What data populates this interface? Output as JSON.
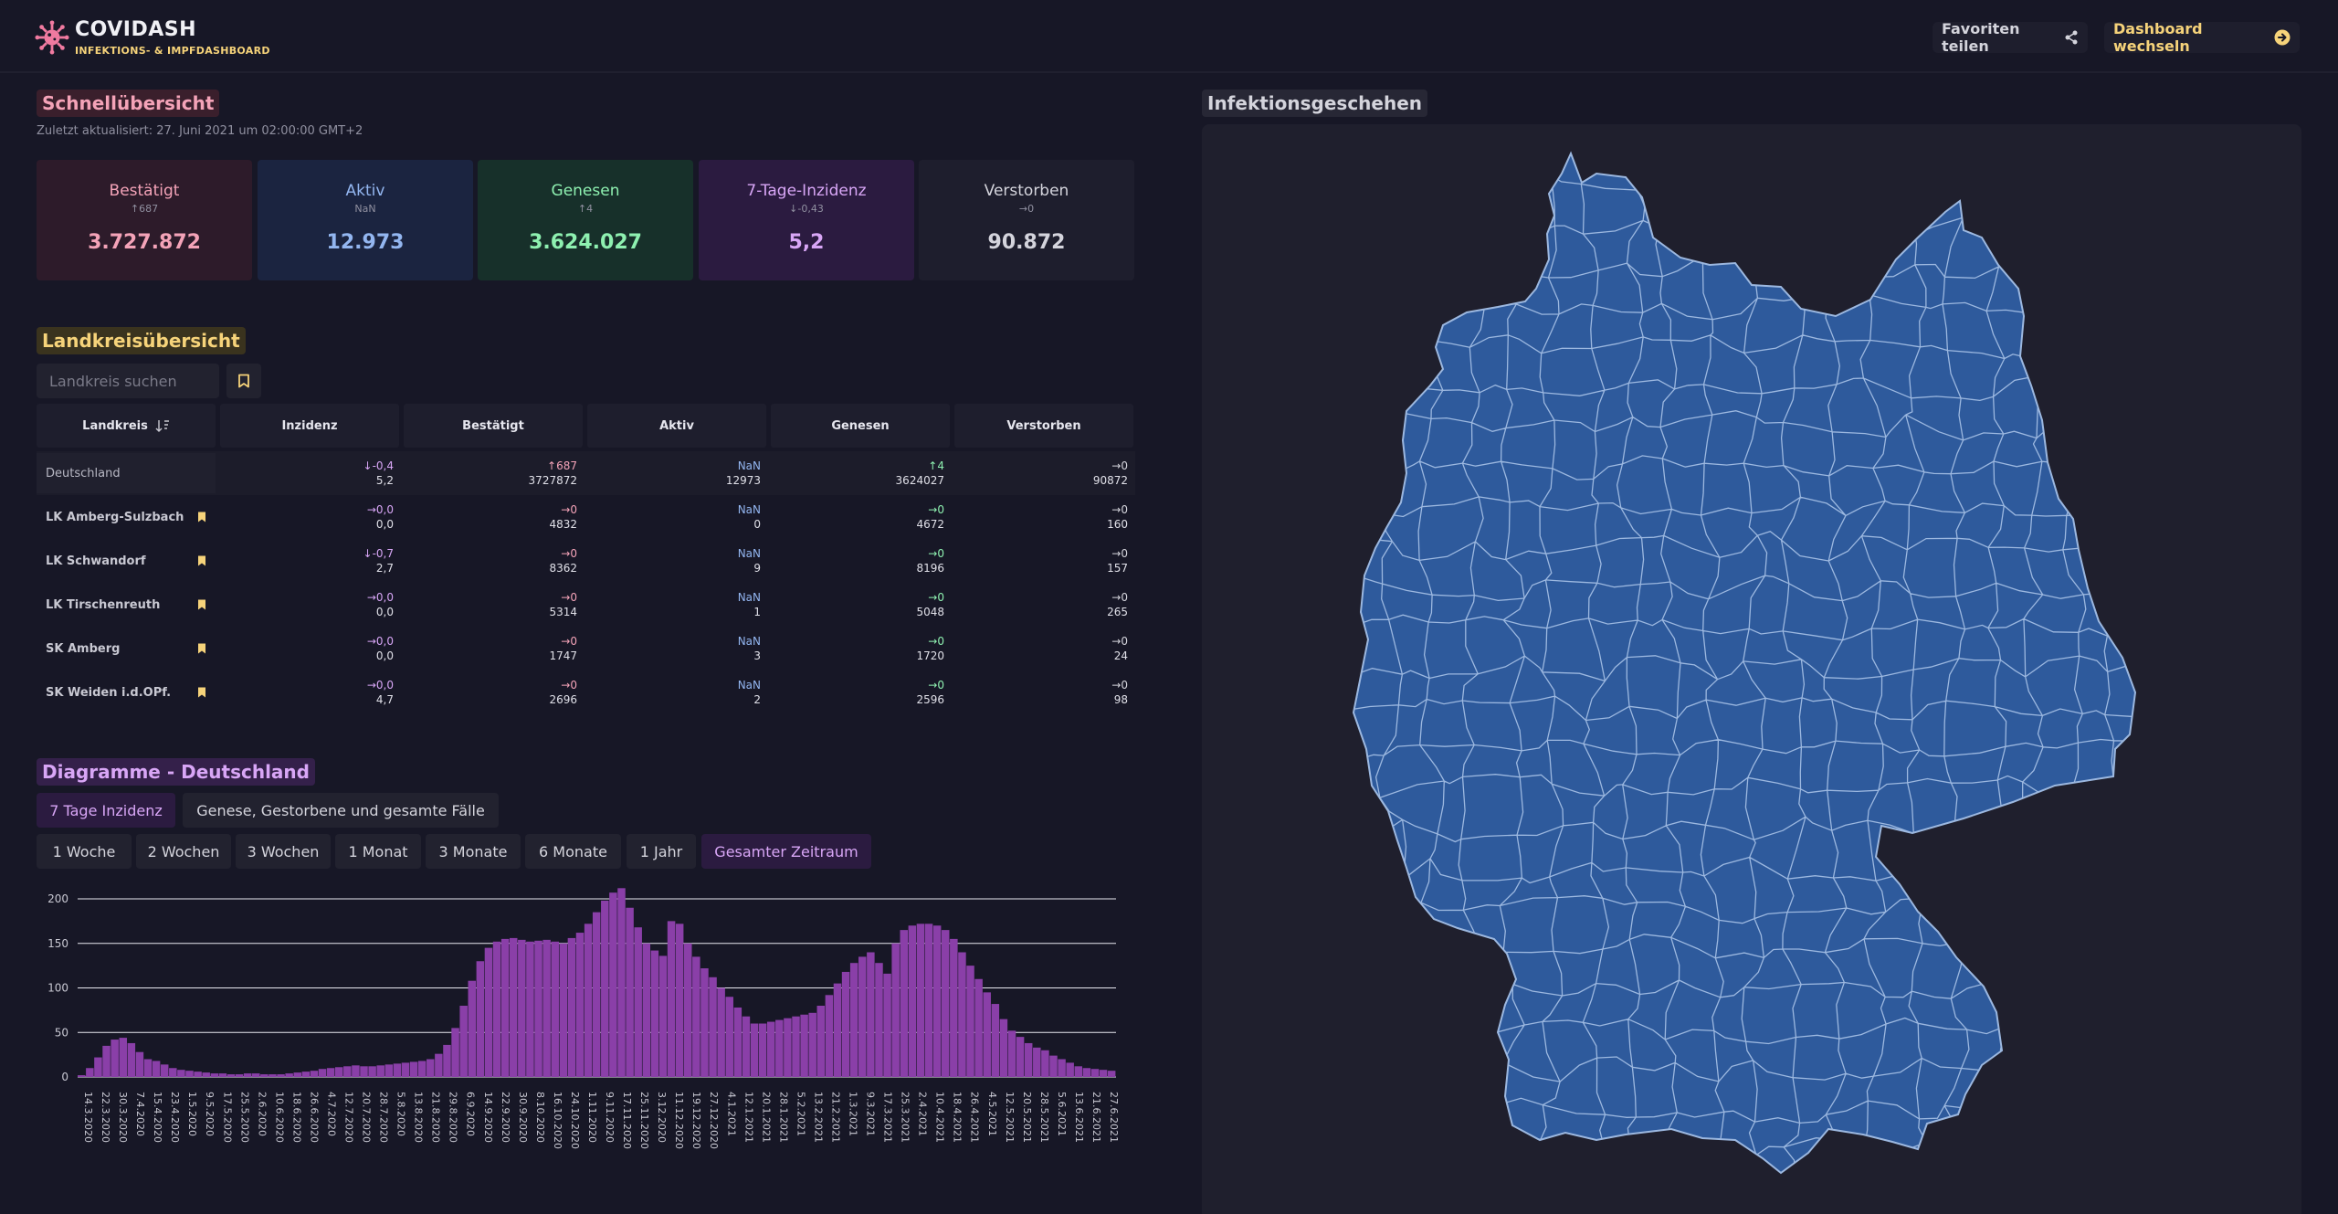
{
  "header": {
    "title": "COVIDASH",
    "subtitle": "INFEKTIONS- & IMPFDASHBOARD",
    "share_label": "Favoriten teilen",
    "switch_label": "Dashboard wechseln",
    "icons": [
      "virus-icon",
      "share-icon",
      "arrow-right-circle-icon"
    ]
  },
  "overview": {
    "title": "Schnellübersicht",
    "updated": "Zuletzt aktualisiert: 27. Juni 2021 um 02:00:00 GMT+2",
    "cards": [
      {
        "label": "Bestätigt",
        "delta": "↑687",
        "value": "3.727.872"
      },
      {
        "label": "Aktiv",
        "delta": "NaN",
        "value": "12.973"
      },
      {
        "label": "Genesen",
        "delta": "↑4",
        "value": "3.624.027"
      },
      {
        "label": "7-Tage-Inzidenz",
        "delta": "↓-0,43",
        "value": "5,2"
      },
      {
        "label": "Verstorben",
        "delta": "→0",
        "value": "90.872"
      }
    ]
  },
  "districts": {
    "title": "Landkreisübersicht",
    "search_placeholder": "Landkreis suchen",
    "columns": [
      "Landkreis",
      "Inzidenz",
      "Bestätigt",
      "Aktiv",
      "Genesen",
      "Verstorben"
    ],
    "rows": [
      {
        "name": "Deutschland",
        "inz_d": "↓-0,4",
        "inz": "5,2",
        "best_d": "↑687",
        "best": "3727872",
        "akt_d": "NaN",
        "akt": "12973",
        "gen_d": "↑4",
        "gen": "3624027",
        "ver_d": "→0",
        "ver": "90872"
      },
      {
        "name": "LK Amberg-Sulzbach",
        "inz_d": "→0,0",
        "inz": "0,0",
        "best_d": "→0",
        "best": "4832",
        "akt_d": "NaN",
        "akt": "0",
        "gen_d": "→0",
        "gen": "4672",
        "ver_d": "→0",
        "ver": "160"
      },
      {
        "name": "LK Schwandorf",
        "inz_d": "↓-0,7",
        "inz": "2,7",
        "best_d": "→0",
        "best": "8362",
        "akt_d": "NaN",
        "akt": "9",
        "gen_d": "→0",
        "gen": "8196",
        "ver_d": "→0",
        "ver": "157"
      },
      {
        "name": "LK Tirschenreuth",
        "inz_d": "→0,0",
        "inz": "0,0",
        "best_d": "→0",
        "best": "5314",
        "akt_d": "NaN",
        "akt": "1",
        "gen_d": "→0",
        "gen": "5048",
        "ver_d": "→0",
        "ver": "265"
      },
      {
        "name": "SK Amberg",
        "inz_d": "→0,0",
        "inz": "0,0",
        "best_d": "→0",
        "best": "1747",
        "akt_d": "NaN",
        "akt": "3",
        "gen_d": "→0",
        "gen": "1720",
        "ver_d": "→0",
        "ver": "24"
      },
      {
        "name": "SK Weiden i.d.OPf.",
        "inz_d": "→0,0",
        "inz": "4,7",
        "best_d": "→0",
        "best": "2696",
        "akt_d": "NaN",
        "akt": "2",
        "gen_d": "→0",
        "gen": "2596",
        "ver_d": "→0",
        "ver": "98"
      }
    ]
  },
  "charts_section": {
    "title": "Diagramme - Deutschland",
    "type_tabs": [
      "7 Tage Inzidenz",
      "Genese, Gestorbene und gesamte Fälle"
    ],
    "active_type": "7 Tage Inzidenz",
    "range_tabs": [
      "1 Woche",
      "2 Wochen",
      "3 Wochen",
      "1 Monat",
      "3 Monate",
      "6 Monate",
      "1 Jahr",
      "Gesamter Zeitraum"
    ],
    "active_range": "Gesamter Zeitraum"
  },
  "map": {
    "title": "Infektionsgeschehen",
    "fill_color": "#2e5a9c",
    "border_color": "#9cb8e0"
  },
  "colors": {
    "background": "#171726",
    "bar": "#8a3fa8",
    "accent_yellow": "#f6d37a",
    "accent_pink": "#f4a3b8",
    "accent_purple": "#d8a6f6"
  },
  "chart_data": {
    "type": "bar",
    "title": "",
    "xlabel": "",
    "ylabel": "",
    "ylim": [
      0,
      220
    ],
    "yticks": [
      0,
      50,
      100,
      150,
      200
    ],
    "grid": true,
    "x_tick_labels": [
      "14.3.2020",
      "22.3.2020",
      "30.3.2020",
      "7.4.2020",
      "15.4.2020",
      "23.4.2020",
      "1.5.2020",
      "9.5.2020",
      "17.5.2020",
      "25.5.2020",
      "2.6.2020",
      "10.6.2020",
      "18.6.2020",
      "26.6.2020",
      "4.7.2020",
      "12.7.2020",
      "20.7.2020",
      "28.7.2020",
      "5.8.2020",
      "13.8.2020",
      "21.8.2020",
      "29.8.2020",
      "6.9.2020",
      "14.9.2020",
      "22.9.2020",
      "30.9.2020",
      "8.10.2020",
      "16.10.2020",
      "24.10.2020",
      "1.11.2020",
      "9.11.2020",
      "17.11.2020",
      "25.11.2020",
      "3.12.2020",
      "11.12.2020",
      "19.12.2020",
      "27.12.2020",
      "4.1.2021",
      "12.1.2021",
      "20.1.2021",
      "28.1.2021",
      "5.2.2021",
      "13.2.2021",
      "21.2.2021",
      "1.3.2021",
      "9.3.2021",
      "17.3.2021",
      "25.3.2021",
      "2.4.2021",
      "10.4.2021",
      "18.4.2021",
      "26.4.2021",
      "4.5.2021",
      "12.5.2021",
      "20.5.2021",
      "28.5.2021",
      "5.6.2021",
      "13.6.2021",
      "21.6.2021",
      "27.6.2021"
    ],
    "series": [
      {
        "values": [
          2,
          10,
          22,
          35,
          42,
          44,
          38,
          28,
          20,
          18,
          14,
          10,
          8,
          7,
          6,
          5,
          4,
          4,
          3,
          3,
          4,
          4,
          3,
          3,
          3,
          4,
          5,
          6,
          7,
          9,
          10,
          11,
          12,
          13,
          12,
          12,
          13,
          14,
          15,
          16,
          17,
          18,
          20,
          26,
          36,
          55,
          80,
          108,
          130,
          145,
          152,
          155,
          156,
          154,
          152,
          153,
          154,
          152,
          150,
          156,
          162,
          172,
          185,
          198,
          207,
          212,
          190,
          168,
          150,
          142,
          136,
          175,
          172,
          150,
          135,
          122,
          112,
          100,
          90,
          78,
          68,
          60,
          60,
          62,
          64,
          66,
          68,
          70,
          72,
          80,
          92,
          105,
          118,
          128,
          135,
          140,
          128,
          116,
          150,
          165,
          170,
          172,
          172,
          170,
          165,
          155,
          140,
          125,
          110,
          95,
          82,
          65,
          52,
          45,
          38,
          33,
          30,
          24,
          20,
          16,
          12,
          10,
          9,
          8,
          7
        ]
      }
    ]
  }
}
